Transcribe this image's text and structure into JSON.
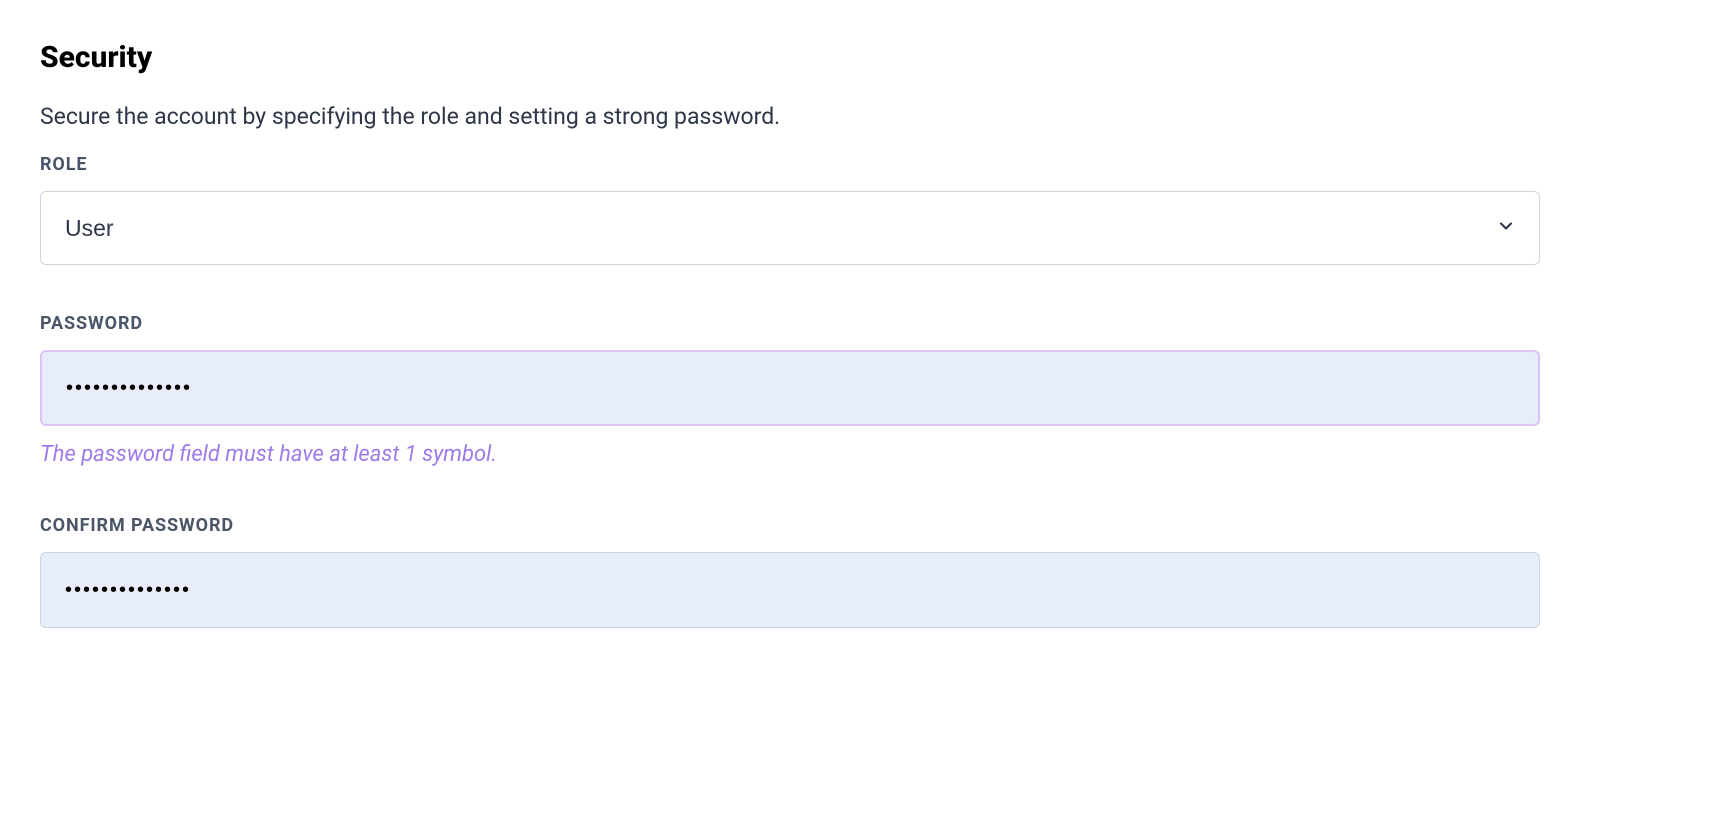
{
  "section": {
    "title": "Security",
    "description": "Secure the account by specifying the role and setting a strong password."
  },
  "fields": {
    "role": {
      "label": "ROLE",
      "value": "User"
    },
    "password": {
      "label": "PASSWORD",
      "value": "••••••••••••••",
      "validation_message": "The password field must have at least 1 symbol."
    },
    "confirm_password": {
      "label": "CONFIRM PASSWORD",
      "value": "••••••••••••••"
    }
  }
}
